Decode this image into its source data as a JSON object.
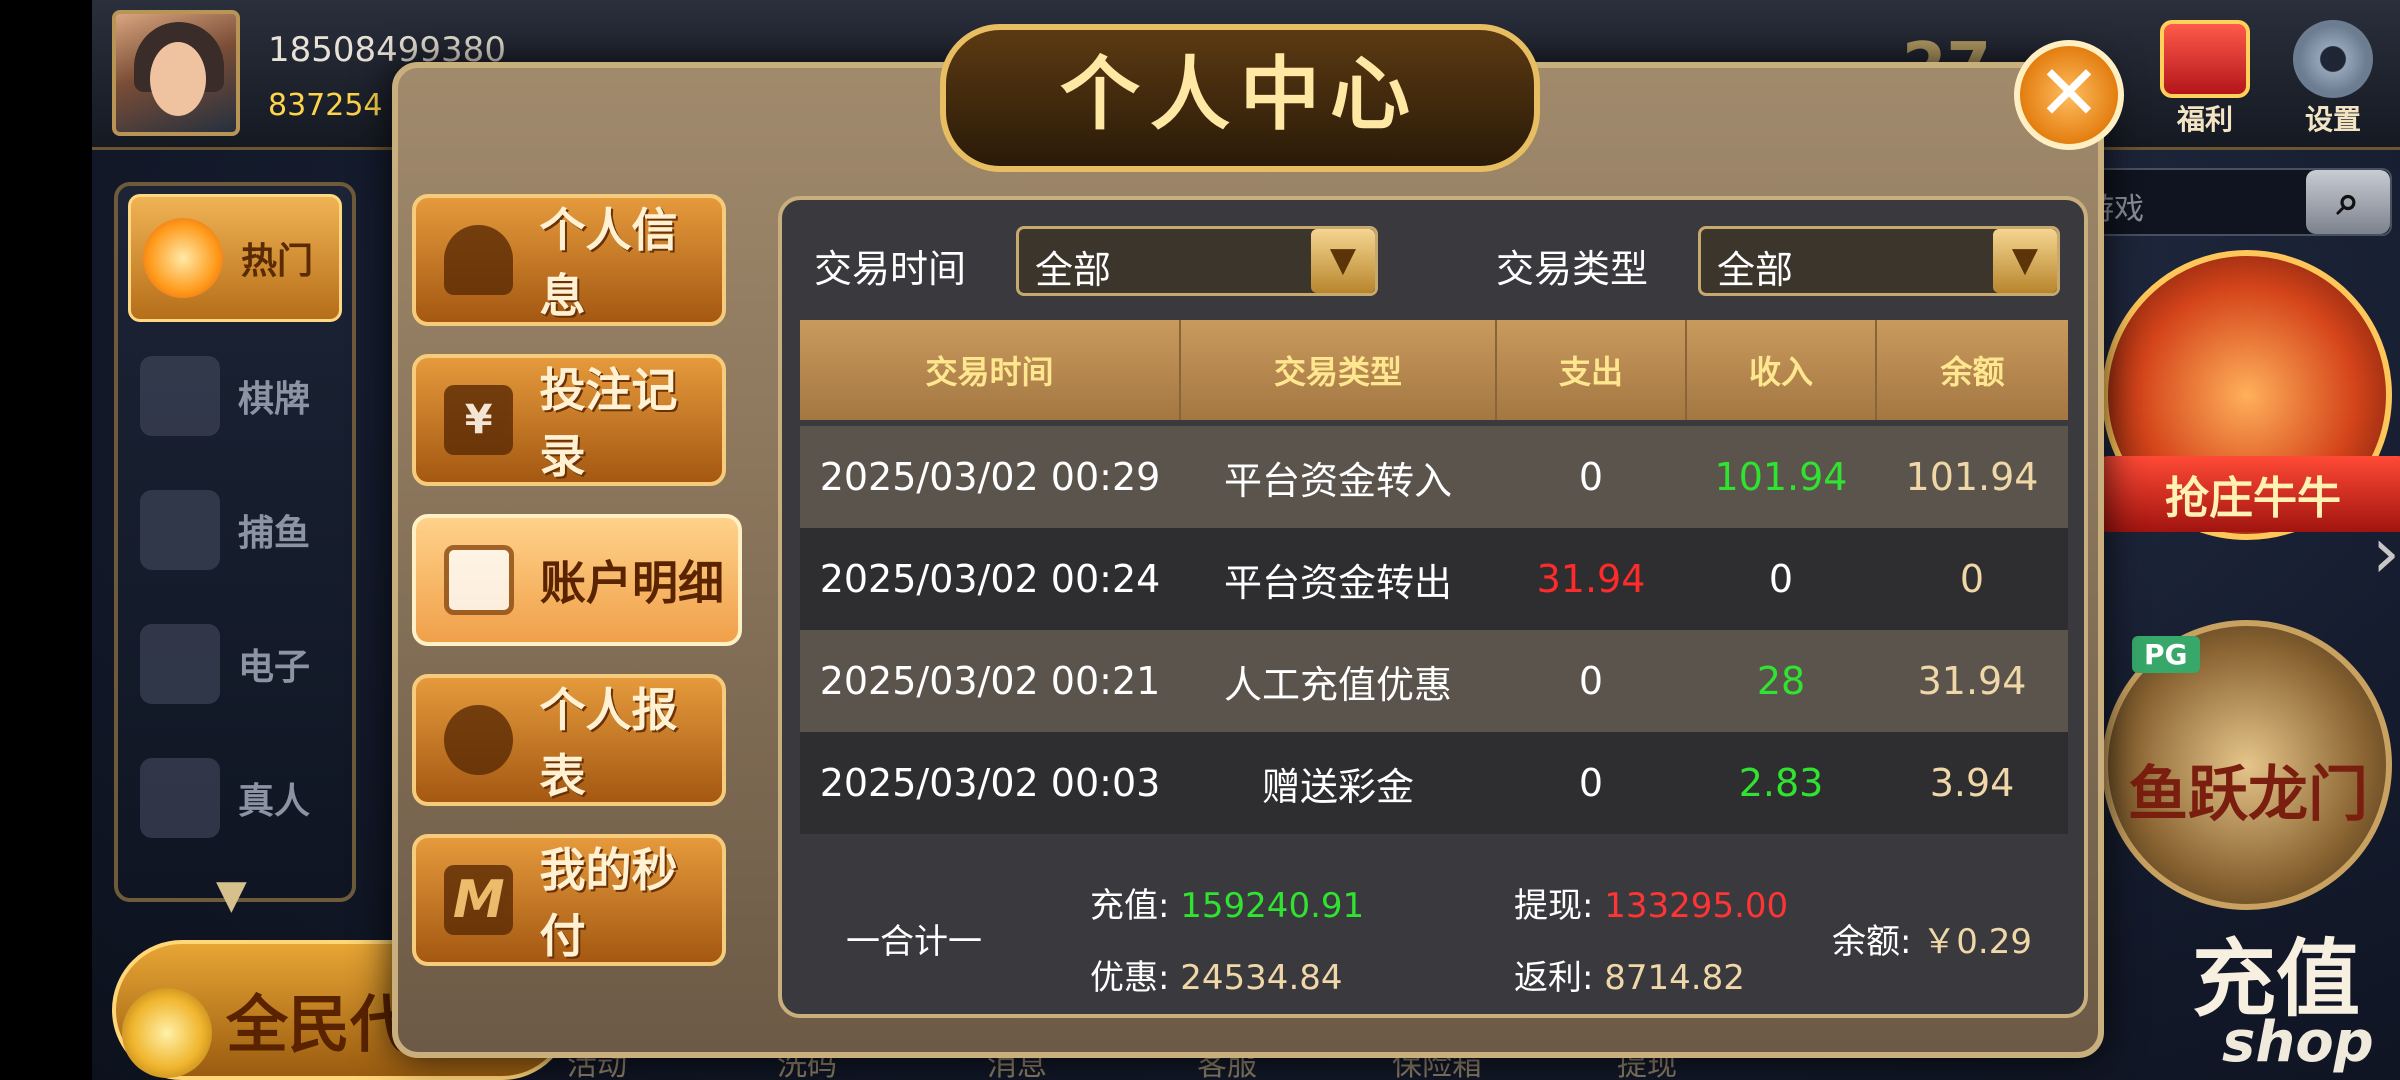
{
  "header": {
    "user_phone": "18508499380",
    "user_coins": "837254",
    "big_number": "27",
    "gift_label": "福利",
    "settings_label": "设置",
    "search_placeholder": "游戏"
  },
  "left_nav": {
    "items": [
      {
        "label": "热门",
        "badge": "HOT",
        "active": true
      },
      {
        "label": "棋牌"
      },
      {
        "label": "捕鱼"
      },
      {
        "label": "电子"
      },
      {
        "label": "真人"
      }
    ],
    "more_icon": "▼"
  },
  "promo": {
    "label": "全民代"
  },
  "games": {
    "niuniu_label": "抢庄牛牛",
    "dragon_label": "鱼跃龙门",
    "pg_badge": "PG",
    "recharge_label": "充值",
    "recharge_sub": "shop"
  },
  "bottom_nav": [
    "活动",
    "洗码",
    "消息",
    "客服",
    "保险箱",
    "提现"
  ],
  "modal": {
    "title": "个人中心",
    "close_icon": "✕",
    "side_menu": [
      {
        "label": "个人信息",
        "icon": "user-icon"
      },
      {
        "label": "投注记录",
        "icon": "yen-note-icon",
        "glyph": "¥"
      },
      {
        "label": "账户明细",
        "icon": "ledger-search-icon",
        "active": true
      },
      {
        "label": "个人报表",
        "icon": "pie-chart-icon"
      },
      {
        "label": "我的秒付",
        "icon": "m-logo-icon",
        "glyph": "M"
      }
    ],
    "filters": {
      "time_label": "交易时间",
      "time_value": "全部",
      "type_label": "交易类型",
      "type_value": "全部"
    },
    "table": {
      "headers": [
        "交易时间",
        "交易类型",
        "支出",
        "收入",
        "余额"
      ],
      "rows": [
        {
          "time": "2025/03/02 00:29",
          "type": "平台资金转入",
          "out": "0",
          "in": "101.94",
          "balance": "101.94"
        },
        {
          "time": "2025/03/02 00:24",
          "type": "平台资金转出",
          "out": "31.94",
          "in": "0",
          "balance": "0"
        },
        {
          "time": "2025/03/02 00:21",
          "type": "人工充值优惠",
          "out": "0",
          "in": "28",
          "balance": "31.94"
        },
        {
          "time": "2025/03/02 00:03",
          "type": "赠送彩金",
          "out": "0",
          "in": "2.83",
          "balance": "3.94"
        }
      ]
    },
    "summary": {
      "label": "一合计一",
      "recharge_label": "充值:",
      "recharge_value": "159240.91",
      "discount_label": "优惠:",
      "discount_value": "24534.84",
      "withdraw_label": "提现:",
      "withdraw_value": "133295.00",
      "rebate_label": "返利:",
      "rebate_value": "8714.82",
      "balance_label": "余额:",
      "balance_value": "￥0.29"
    }
  },
  "colors": {
    "income_green": "#31e331",
    "expense_red": "#ff2a2a",
    "balance_tan": "#f0d7a8",
    "gold_border": "#c9ae7e"
  }
}
